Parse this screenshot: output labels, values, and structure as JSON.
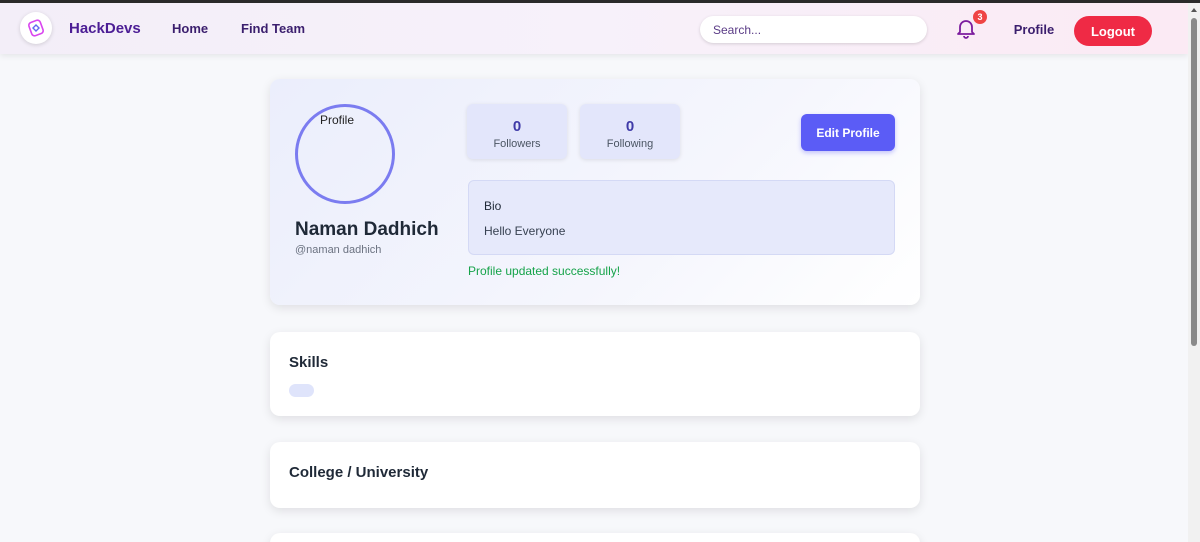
{
  "navbar": {
    "logo_icon": "hackdevs-logo-icon",
    "brand": "HackDevs",
    "links": [
      "Home",
      "Find Team"
    ],
    "search_placeholder": "Search...",
    "notification_icon": "bell-icon",
    "notification_count": "3",
    "profile_label": "Profile",
    "logout_label": "Logout"
  },
  "profile": {
    "avatar_alt_text": "Profile",
    "name": "Naman Dadhich",
    "username": "@naman dadhich",
    "stats": [
      {
        "value": "0",
        "label": "Followers"
      },
      {
        "value": "0",
        "label": "Following"
      }
    ],
    "edit_button_label": "Edit Profile",
    "bio_title": "Bio",
    "bio_text": "Hello Everyone",
    "status_message": "Profile updated successfully!"
  },
  "sections": {
    "skills_title": "Skills",
    "skills": [],
    "college_title": "College / University"
  },
  "colors": {
    "brand": "#4c1d95",
    "accent": "#5b5cf6",
    "logout": "#ef2a45",
    "success": "#16a34a"
  }
}
